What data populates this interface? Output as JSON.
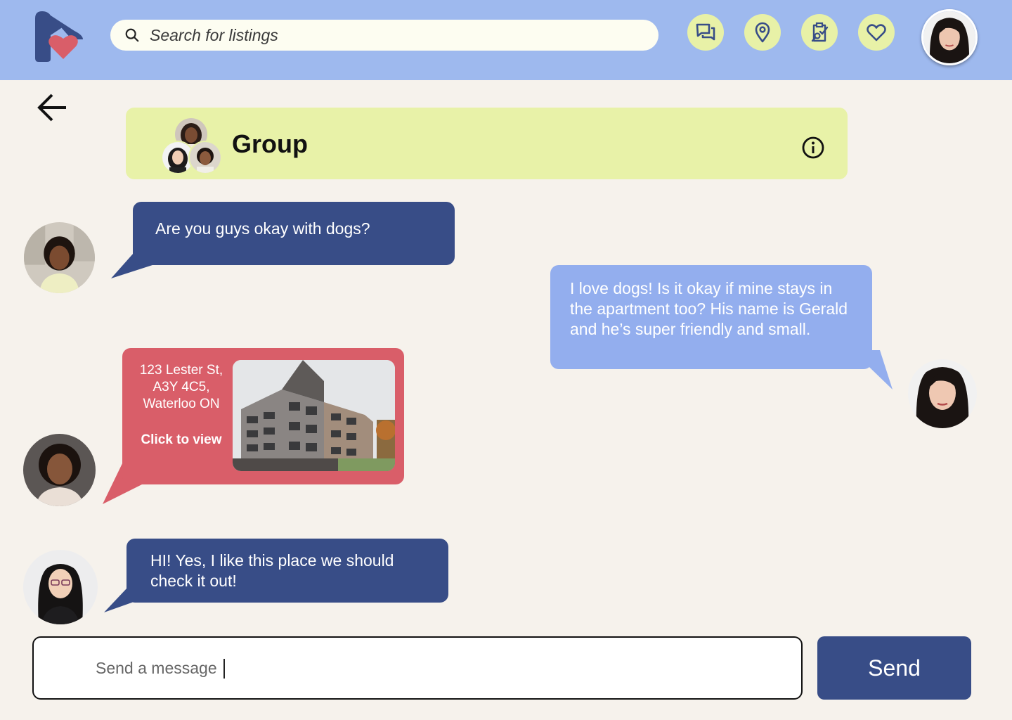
{
  "header": {
    "search": {
      "placeholder": "Search for listings",
      "value": ""
    },
    "nav": [
      "chat-icon",
      "map-pin-icon",
      "clipboard-search-icon",
      "heart-icon"
    ]
  },
  "chat": {
    "title": "Group",
    "messages": [
      {
        "sender": "them",
        "text": "Are you guys okay with dogs?"
      },
      {
        "sender": "me",
        "text": "I love dogs! Is it okay if mine stays in the apartment too? His name is Gerald and he’s super friendly and small."
      },
      {
        "sender": "them",
        "type": "listing",
        "address_line1": "123 Lester St,",
        "address_line2": "A3Y 4C5,",
        "address_line3": "Waterloo ON",
        "cta": "Click to view"
      },
      {
        "sender": "them",
        "text": "HI! Yes, I like this place we should check it out!"
      }
    ]
  },
  "composer": {
    "placeholder": "Send a message",
    "value": "",
    "send_label": "Send"
  },
  "colors": {
    "header": "#9eb9ee",
    "background": "#f6f2ec",
    "accent_yellow": "#e8f2a8",
    "bubble_dark": "#384d87",
    "bubble_light": "#93aeee",
    "bubble_red": "#d95e69"
  }
}
